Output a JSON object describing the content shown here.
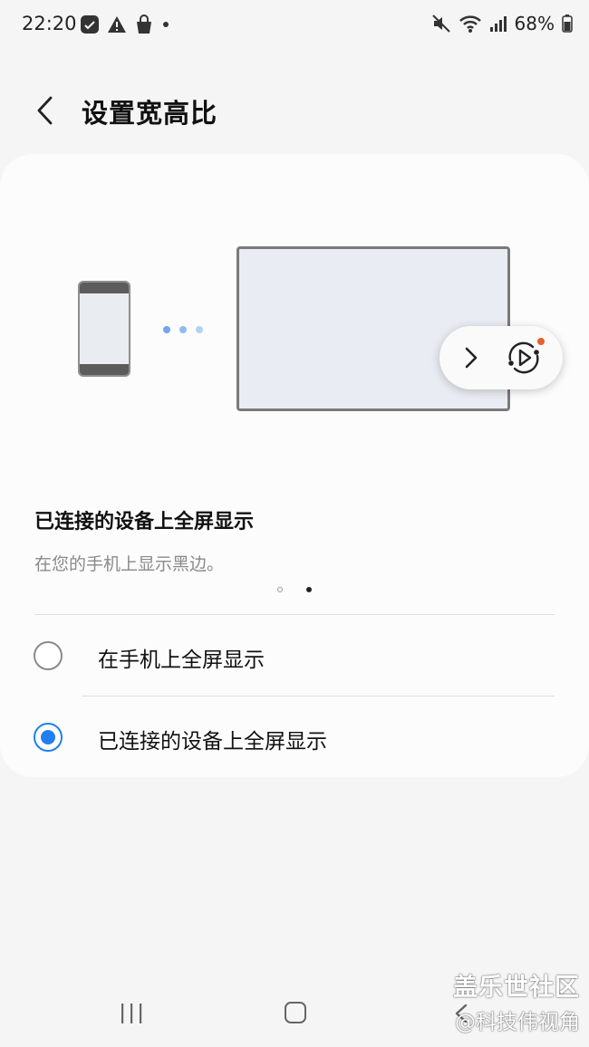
{
  "status_bar": {
    "time": "22:20",
    "battery": "68%",
    "left_icons": [
      "screenshot-icon",
      "warning-icon",
      "shopping-bag-icon",
      "notification-dot-icon"
    ],
    "right_icons": [
      "mute-icon",
      "wifi-icon",
      "signal-icon",
      "battery-icon"
    ]
  },
  "header": {
    "title": "设置宽高比",
    "back_icon": "back-chevron-icon"
  },
  "illustration": {
    "arrow_icon": "chevron-right-icon",
    "cast_icon": "smart-view-icon",
    "accent_color": "#1f7ff0",
    "badge_color": "#e8612c"
  },
  "option_info": {
    "title": "已连接的设备上全屏显示",
    "description": "在您的手机上显示黑边。",
    "page_total": 2,
    "page_current": 2
  },
  "options": [
    {
      "label": "在手机上全屏显示",
      "selected": false
    },
    {
      "label": "已连接的设备上全屏显示",
      "selected": true
    }
  ],
  "nav_bar": {
    "icons": [
      "recents-icon",
      "home-icon",
      "back-icon"
    ]
  },
  "watermark": {
    "line1": "盖乐世社区",
    "line2": "@科技伟视角"
  }
}
